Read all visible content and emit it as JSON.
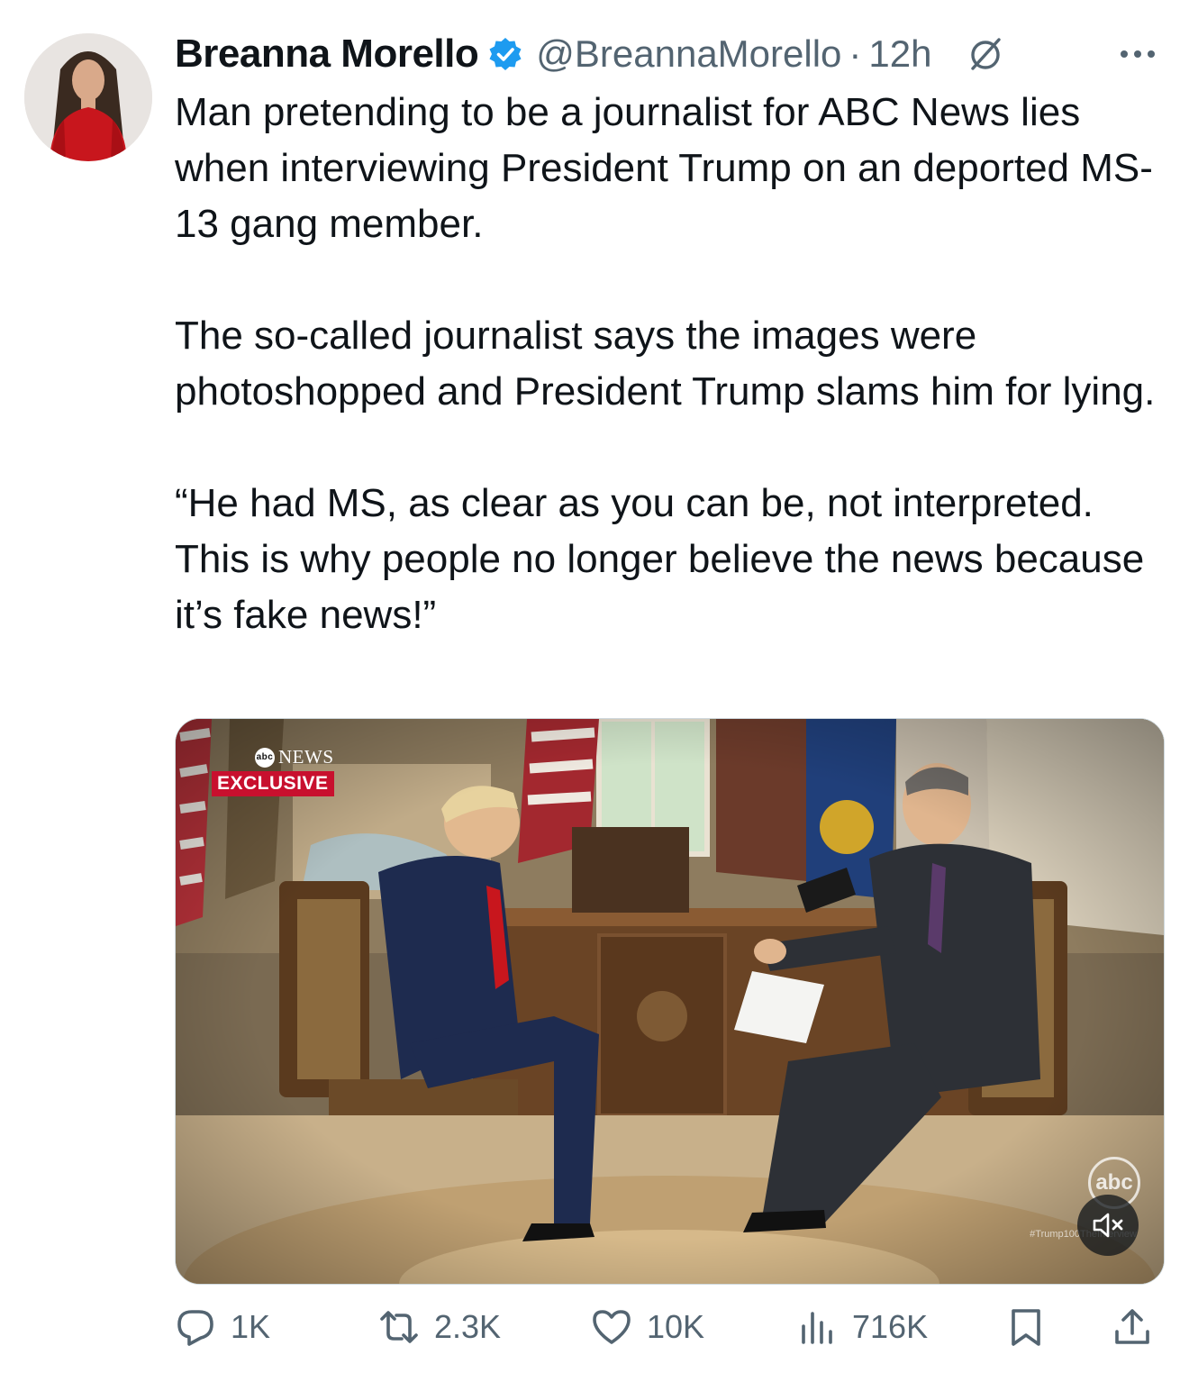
{
  "post": {
    "author_name": "Breanna Morello",
    "handle": "@BreannaMorello",
    "separator": "·",
    "time": "12h",
    "paragraphs": [
      "Man pretending to be a journalist for ABC News lies when interviewing President Trump on an deported MS-13 gang member.",
      "The so-called journalist says the images were photoshopped and President Trump slams him for lying.",
      "“He had MS, as clear as you can be, not interpreted. This is why people no longer believe the news because it’s fake news!”"
    ]
  },
  "media": {
    "badge_logo": "abc",
    "badge_news": "NEWS",
    "badge_exclusive": "EXCLUSIVE",
    "watermark": "abc",
    "hashtag": "#Trump100TheInterview",
    "mute_icon": "speaker-muted-icon"
  },
  "actions": {
    "replies": "1K",
    "reposts": "2.3K",
    "likes": "10K",
    "views": "716K"
  },
  "colors": {
    "verified": "#1d9bf0",
    "secondary_text": "#536471",
    "exclusive_red": "#c8102e"
  }
}
